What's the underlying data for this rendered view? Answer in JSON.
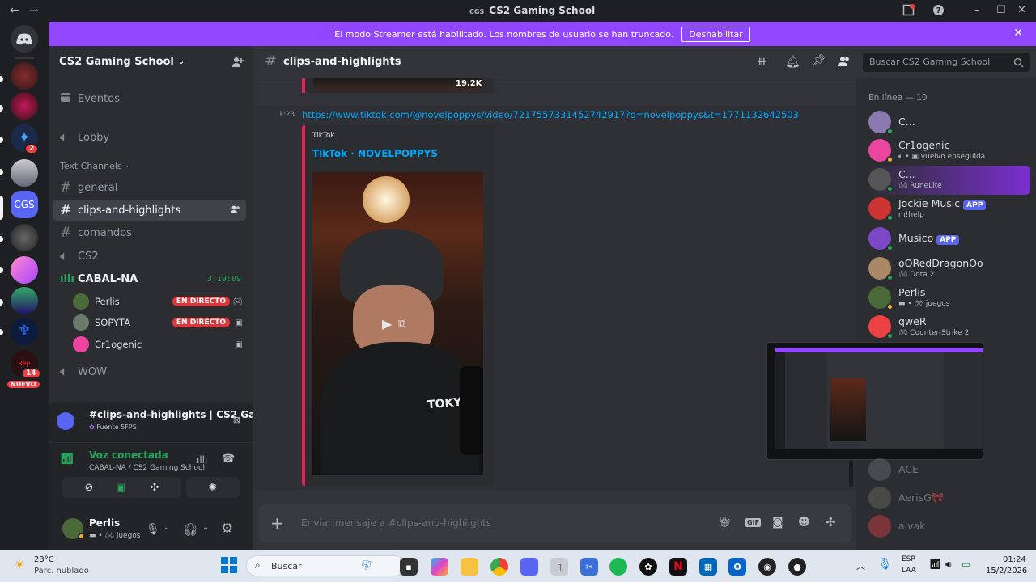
{
  "window": {
    "title": "CS2 Gaming School",
    "back": "←",
    "forward": "→"
  },
  "banner": {
    "text": "El modo Streamer está habilitado. Los nombres de usuario se han truncado.",
    "button": "Deshabilitar"
  },
  "rail": {
    "new_label": "NUEVO",
    "badge_a": "2",
    "badge_b": "14",
    "active_server": "CGS"
  },
  "sidebar": {
    "server_name": "CS2 Gaming School",
    "events": "Eventos",
    "lobby": "Lobby",
    "category": "Text Channels",
    "channels": [
      "general",
      "clips-and-highlights",
      "comandos",
      "CS2"
    ],
    "voice_channel": "CABAL-NA",
    "voice_timer": "3:19:09",
    "voice_users": [
      {
        "name": "Perlis",
        "live": "EN DIRECTO"
      },
      {
        "name": "SOPYTA",
        "live": "EN DIRECTO"
      },
      {
        "name": "Cr1ogenic",
        "live": ""
      }
    ],
    "wow": "WOW"
  },
  "stream_panel": {
    "title": "#clips-and-highlights | CS2 Gaming...",
    "subtitle": "Fuente 5FPS"
  },
  "voice_panel": {
    "status": "Voz conectada",
    "location": "CABAL-NA / CS2 Gaming School"
  },
  "user_panel": {
    "name": "Perlis",
    "status": "juegos"
  },
  "header": {
    "channel": "clips-and-highlights",
    "search_placeholder": "Buscar CS2 Gaming School"
  },
  "message": {
    "views": "19.2K",
    "time": "1:23",
    "link": "https://www.tiktok.com/@novelpoppys/video/7217557331452742917?q=novelpoppys&t=1771132642503",
    "embed_provider": "TikTok",
    "embed_title": "TikTok · NOVELPOPPYS",
    "shirt_text": "TOKYO"
  },
  "composer": {
    "placeholder": "Enviar mensaje a #clips-and-highlights",
    "gif": "GIF"
  },
  "members": {
    "heading": "En línea — 10",
    "list": [
      {
        "name": "C...",
        "status": ""
      },
      {
        "name": "Cr1ogenic",
        "status": "vuelvo enseguida"
      },
      {
        "name": "C...",
        "status": "RuneLite"
      },
      {
        "name": "Jockie Music",
        "status": "m!help",
        "tag": "APP"
      },
      {
        "name": "Musico",
        "status": "",
        "tag": "APP"
      },
      {
        "name": "oORedDragonOo",
        "status": "Dota 2"
      },
      {
        "name": "Perlis",
        "status": "juegos"
      },
      {
        "name": "qweR",
        "status": "Counter-Strike 2"
      }
    ],
    "offline": [
      "ACE",
      "AerisG🎀",
      "alvak"
    ]
  },
  "colors": {
    "accent": "#9147ff",
    "live": "#da373c",
    "online": "#23a55a",
    "link": "#00a8fc",
    "embed_bar": "#ee1d52"
  },
  "taskbar": {
    "temp": "23°C",
    "weather": "Parc. nublado",
    "search": "Buscar",
    "lang": "ESP",
    "lang2": "LAA",
    "time": "01:24",
    "date": "15/2/2026"
  }
}
